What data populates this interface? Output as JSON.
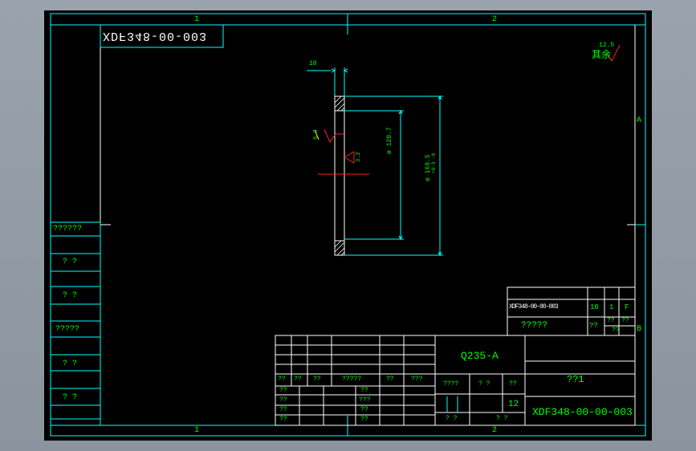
{
  "zone_markers": {
    "top_1": "1",
    "top_2": "2",
    "bottom_1": "1",
    "bottom_2": "2",
    "right_A": "A",
    "right_B": "B"
  },
  "reverse_code": "XDF348-00-003",
  "surface_finish": {
    "label": "其余",
    "value": "12.5"
  },
  "dimensions": {
    "thickness": "10",
    "inner_dia": "ø 120.7",
    "outer_dia": "ø 169.5",
    "outer_tol": "+0.3\n-0",
    "roughness_1": "6.3",
    "roughness_2": "3.2"
  },
  "left_stamps": [
    "??????",
    "? ?",
    "? ?",
    "?????",
    "? ?",
    "? ?"
  ],
  "parts_list": {
    "code": "XDF348-00-00-003",
    "qty": "10",
    "count": "1",
    "mark": "F",
    "name": "?????",
    "c1": "??",
    "c2": "??",
    "c3": "??",
    "c4": "??"
  },
  "title_block": {
    "material": "Q235-A",
    "part_name": "??1",
    "drawing_no": "XDF348-00-00-003",
    "scale": "12",
    "rev_row": [
      "??",
      "??",
      "??",
      "?????",
      "??",
      "???"
    ],
    "sign_rows": [
      [
        "??",
        "??"
      ],
      [
        "??",
        "???"
      ],
      [
        "??",
        "??"
      ],
      [
        "??",
        "??"
      ]
    ],
    "stage_row": [
      "????",
      "? ?",
      "??"
    ],
    "sheet_row": [
      "? ?",
      "? ?"
    ]
  }
}
